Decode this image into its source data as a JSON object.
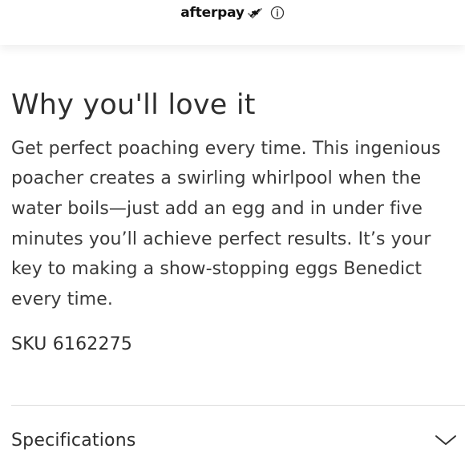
{
  "header": {
    "payment_brand": "afterpay",
    "payment_logo_icon": "afterpay-arrows-icon",
    "info_icon": "info-circle-icon"
  },
  "product_details": {
    "title": "Why you'll love it",
    "description": "Get perfect poaching every time. This ingenious poacher creates a swirling whirlpool when the water boils—just add an egg and in under five minutes you’ll achieve perfect results. It’s your key to making a show-stopping eggs Benedict every time.",
    "sku": "SKU 6162275"
  },
  "accordion": {
    "specifications_label": "Specifications",
    "chevron_icon": "chevron-down-icon"
  },
  "colors": {
    "text_primary": "#2f2f2f",
    "divider": "#dddddd",
    "background": "#ffffff"
  }
}
